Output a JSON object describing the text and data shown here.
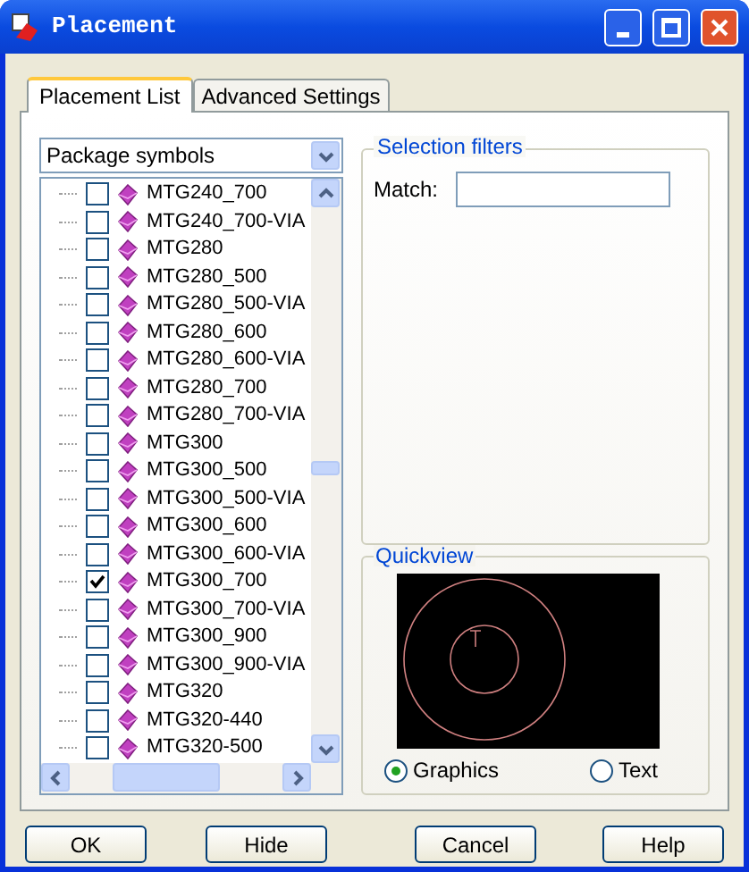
{
  "window": {
    "title": "Placement"
  },
  "tabs": [
    {
      "label": "Placement List",
      "selected": true
    },
    {
      "label": "Advanced Settings",
      "selected": false
    }
  ],
  "symbol_type": {
    "value": "Package symbols"
  },
  "symbols": [
    {
      "name": "MTG240_700",
      "checked": false
    },
    {
      "name": "MTG240_700-VIA",
      "checked": false
    },
    {
      "name": "MTG280",
      "checked": false
    },
    {
      "name": "MTG280_500",
      "checked": false
    },
    {
      "name": "MTG280_500-VIA",
      "checked": false
    },
    {
      "name": "MTG280_600",
      "checked": false
    },
    {
      "name": "MTG280_600-VIA",
      "checked": false
    },
    {
      "name": "MTG280_700",
      "checked": false
    },
    {
      "name": "MTG280_700-VIA",
      "checked": false
    },
    {
      "name": "MTG300",
      "checked": false
    },
    {
      "name": "MTG300_500",
      "checked": false
    },
    {
      "name": "MTG300_500-VIA",
      "checked": false
    },
    {
      "name": "MTG300_600",
      "checked": false
    },
    {
      "name": "MTG300_600-VIA",
      "checked": false
    },
    {
      "name": "MTG300_700",
      "checked": true
    },
    {
      "name": "MTG300_700-VIA",
      "checked": false
    },
    {
      "name": "MTG300_900",
      "checked": false
    },
    {
      "name": "MTG300_900-VIA",
      "checked": false
    },
    {
      "name": "MTG320",
      "checked": false
    },
    {
      "name": "MTG320-440",
      "checked": false
    },
    {
      "name": "MTG320-500",
      "checked": false
    }
  ],
  "selection_filters": {
    "title": "Selection filters",
    "match_label": "Match:"
  },
  "quickview": {
    "title": "Quickview",
    "options": [
      {
        "label": "Graphics",
        "selected": true
      },
      {
        "label": "Text",
        "selected": false
      }
    ]
  },
  "buttons": [
    "OK",
    "Hide",
    "Cancel",
    "Help"
  ]
}
